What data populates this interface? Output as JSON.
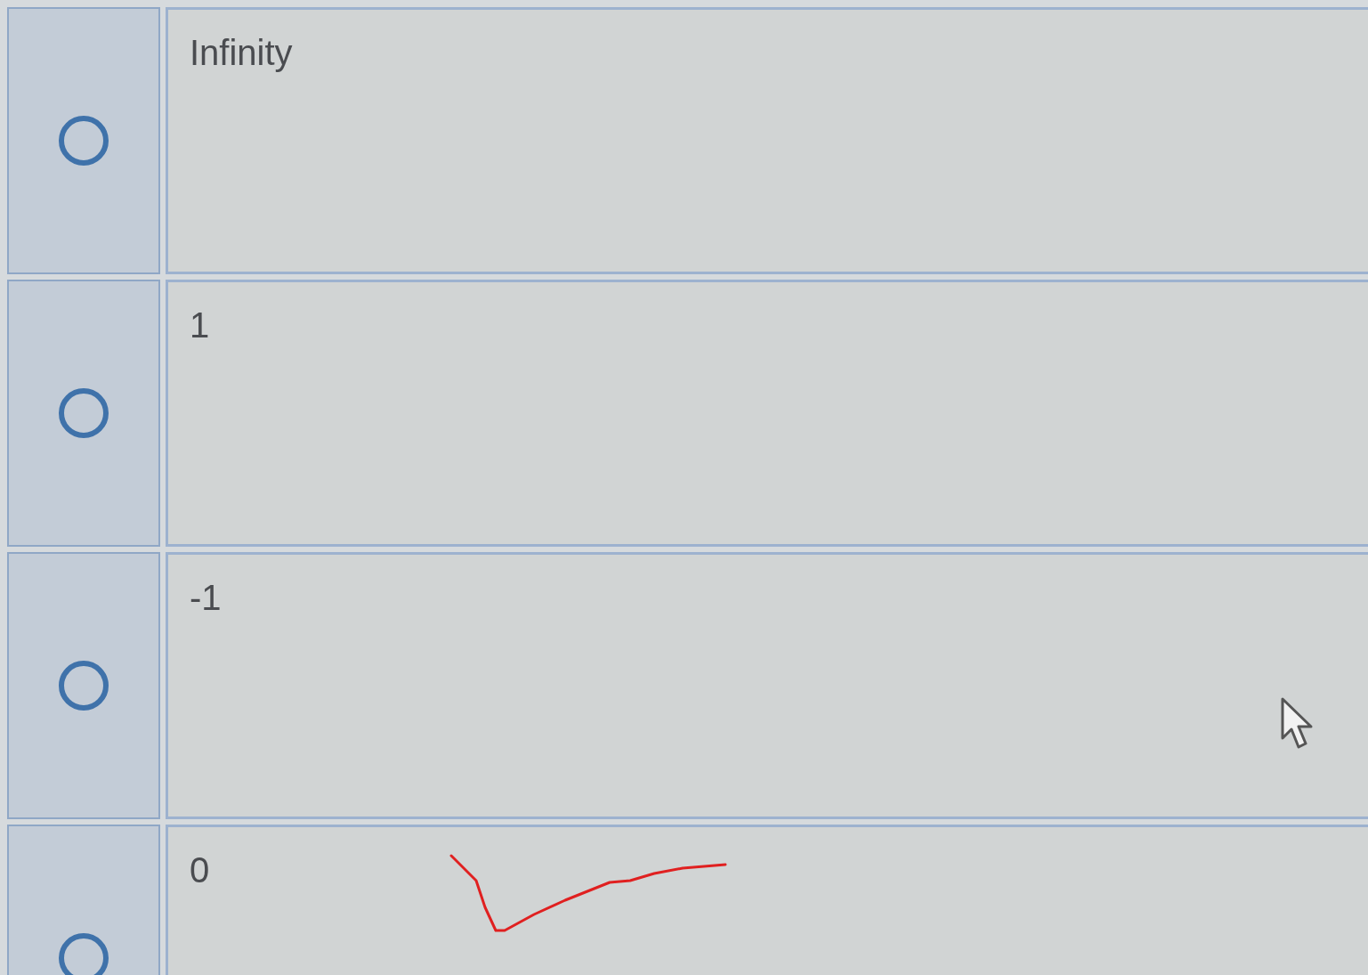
{
  "options": [
    {
      "label": "Infinity",
      "selected": false
    },
    {
      "label": "1",
      "selected": false
    },
    {
      "label": "-1",
      "selected": false
    },
    {
      "label": "0",
      "selected": false
    }
  ]
}
